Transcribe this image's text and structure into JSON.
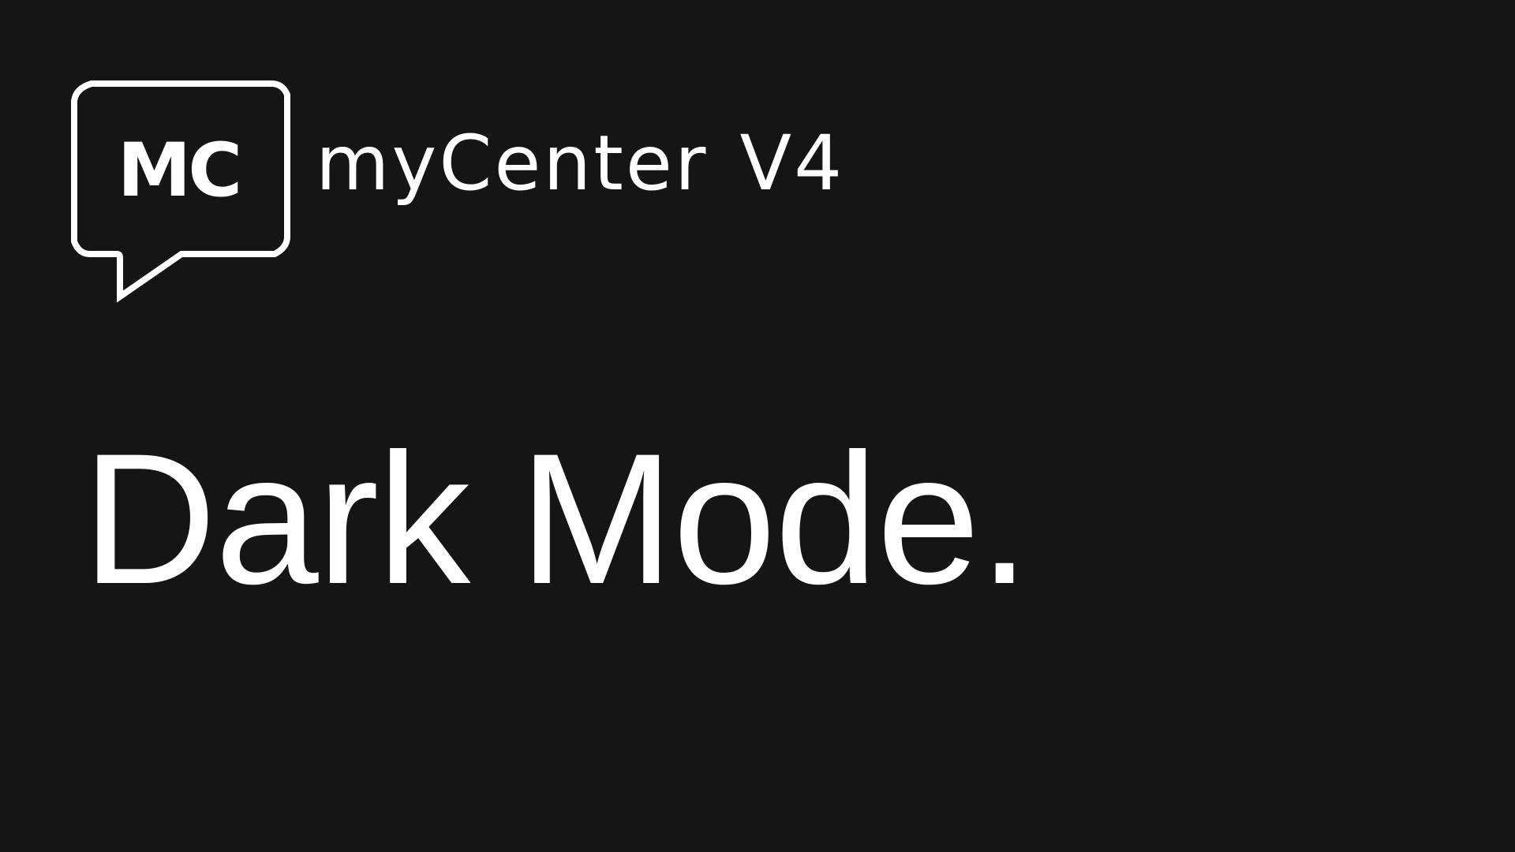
{
  "brand": {
    "logo_initials": "MC",
    "logo_icon": "speech-bubble-icon",
    "app_name": "myCenter",
    "version": "V4"
  },
  "headline": "Dark Mode.",
  "colors": {
    "background": "#151515",
    "foreground": "#ffffff"
  }
}
